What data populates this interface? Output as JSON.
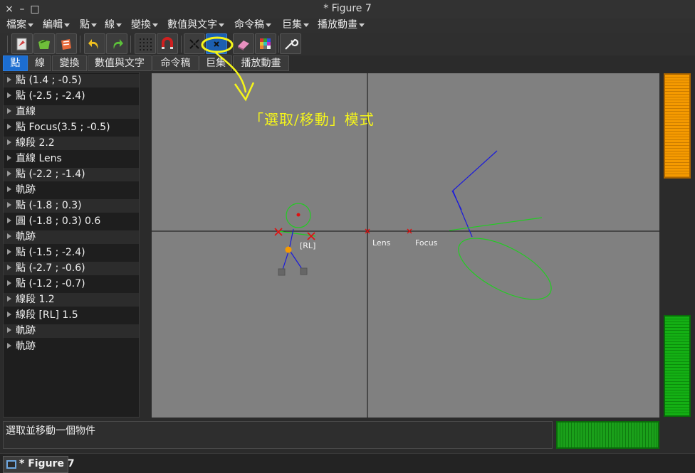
{
  "window": {
    "title": "* Figure 7",
    "close_glyph": "×",
    "minimize_glyph": "–",
    "maximize_glyph": "□"
  },
  "menubar": {
    "items": [
      {
        "label": "檔案"
      },
      {
        "label": "編輯"
      },
      {
        "label": "點"
      },
      {
        "label": "線"
      },
      {
        "label": "變換"
      },
      {
        "label": "數值與文字"
      },
      {
        "label": "命令稿"
      },
      {
        "label": "巨集"
      },
      {
        "label": "播放動畫"
      }
    ]
  },
  "toolbar": {
    "buttons": [
      {
        "icon": "new-figure-icon"
      },
      {
        "icon": "open-figure-icon"
      },
      {
        "icon": "open-recent-icon"
      },
      {
        "icon": "undo-icon"
      },
      {
        "icon": "redo-icon"
      },
      {
        "icon": "grid-icon"
      },
      {
        "icon": "magnet-icon"
      },
      {
        "icon": "select-move-icon"
      },
      {
        "icon": "select-move-active-icon"
      },
      {
        "icon": "eraser-icon"
      },
      {
        "icon": "palette-icon"
      },
      {
        "icon": "settings-wrench-icon"
      }
    ]
  },
  "tabs": [
    {
      "label": "點",
      "active": true
    },
    {
      "label": "線"
    },
    {
      "label": "變換"
    },
    {
      "label": "數值與文字"
    },
    {
      "label": "命令稿"
    },
    {
      "label": "巨集"
    },
    {
      "label": "播放動畫"
    }
  ],
  "objects": [
    {
      "label": "點 (1.4 ; -0.5)"
    },
    {
      "label": "點 (-2.5 ; -2.4)"
    },
    {
      "label": "直線"
    },
    {
      "label": "點 Focus(3.5 ; -0.5)"
    },
    {
      "label": "線段  2.2"
    },
    {
      "label": "直線 Lens"
    },
    {
      "label": "點 (-2.2 ; -1.4)"
    },
    {
      "label": "軌跡"
    },
    {
      "label": "點 (-1.8 ; 0.3)"
    },
    {
      "label": "圓  (-1.8 ; 0.3) 0.6"
    },
    {
      "label": "軌跡"
    },
    {
      "label": "點 (-1.5 ; -2.4)"
    },
    {
      "label": "點 (-2.7 ; -0.6)"
    },
    {
      "label": "點 (-1.2 ; -0.7)"
    },
    {
      "label": "線段  1.2"
    },
    {
      "label": "線段 [RL] 1.5"
    },
    {
      "label": "軌跡"
    },
    {
      "label": "軌跡"
    }
  ],
  "canvas": {
    "label_rl": "[RL]",
    "label_lens": "Lens",
    "label_focus": "Focus",
    "colors": {
      "background": "#808080",
      "axis": "#111111",
      "circle": "#22cc22",
      "blue_lines": "#1a1adc",
      "point_marker": "#e01010",
      "orange_point": "#f59a00"
    }
  },
  "annotation": {
    "text": "「選取/移動」模式",
    "color": "#f5f51a"
  },
  "status": {
    "text": "選取並移動一個物件"
  },
  "taskbar": {
    "item_label": "* Figure 7"
  }
}
